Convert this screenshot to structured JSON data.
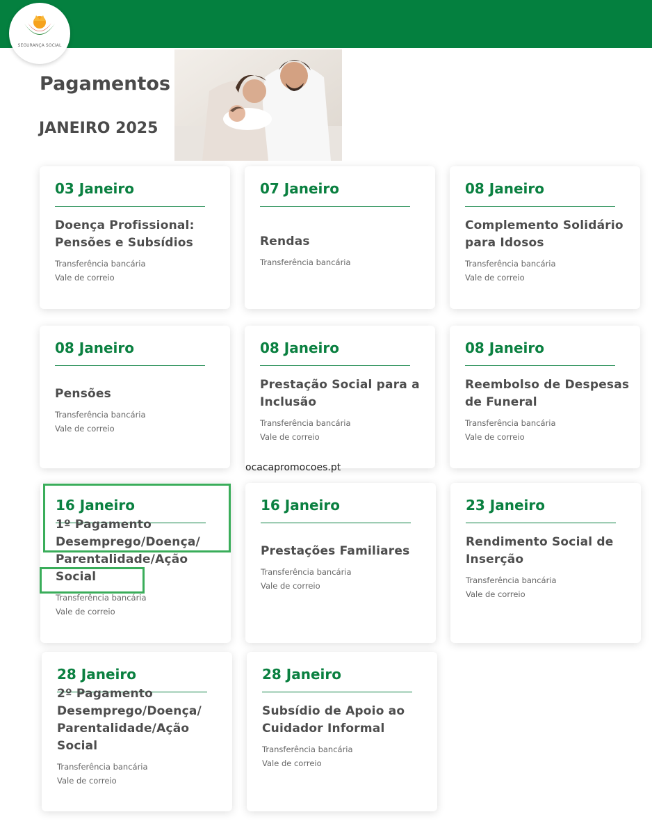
{
  "brand": {
    "logo_text": "SEGURANÇA SOCIAL",
    "colors": {
      "primary_green": "#04803f",
      "date_green": "#0a8040",
      "highlight": "#3aad5a"
    }
  },
  "header": {
    "title": "Pagamentos",
    "month": "JANEIRO 2025"
  },
  "photo": {
    "icon": "family-photo"
  },
  "watermark": "ocacapromocoes.pt",
  "cards": [
    {
      "date": "03 Janeiro",
      "name": "Doença Profissional: Pensões e Subsídios",
      "methods": [
        "Transferência bancária",
        "Vale de correio"
      ]
    },
    {
      "date": "07 Janeiro",
      "name": "Rendas",
      "methods": [
        "Transferência bancária"
      ]
    },
    {
      "date": "08 Janeiro",
      "name": "Complemento Solidário para Idosos",
      "methods": [
        "Transferência bancária",
        "Vale de correio"
      ]
    },
    {
      "date": "08 Janeiro",
      "name": "Pensões",
      "methods": [
        "Transferência bancária",
        "Vale de correio"
      ]
    },
    {
      "date": "08 Janeiro",
      "name": "Prestação Social para a Inclusão",
      "methods": [
        "Transferência bancária",
        "Vale de correio"
      ]
    },
    {
      "date": "08 Janeiro",
      "name": "Reembolso de Despesas de Funeral",
      "methods": [
        "Transferência bancária",
        "Vale de correio"
      ]
    },
    {
      "date": "16 Janeiro",
      "name": "1º Pagamento Desemprego/Doença/ Parentalidade/Ação Social",
      "methods": [
        "Transferência bancária",
        "Vale de correio"
      ]
    },
    {
      "date": "16 Janeiro",
      "name": "Prestações Familiares",
      "methods": [
        "Transferência bancária",
        "Vale de correio"
      ]
    },
    {
      "date": "23 Janeiro",
      "name": "Rendimento Social de Inserção",
      "methods": [
        "Transferência bancária",
        "Vale de correio"
      ]
    },
    {
      "date": "28 Janeiro",
      "name": "2º Pagamento Desemprego/Doença/ Parentalidade/Ação Social",
      "methods": [
        "Transferência bancária",
        "Vale de correio"
      ]
    },
    {
      "date": "28 Janeiro",
      "name": "Subsídio de Apoio ao Cuidador Informal",
      "methods": [
        "Transferência bancária",
        "Vale de correio"
      ]
    }
  ]
}
